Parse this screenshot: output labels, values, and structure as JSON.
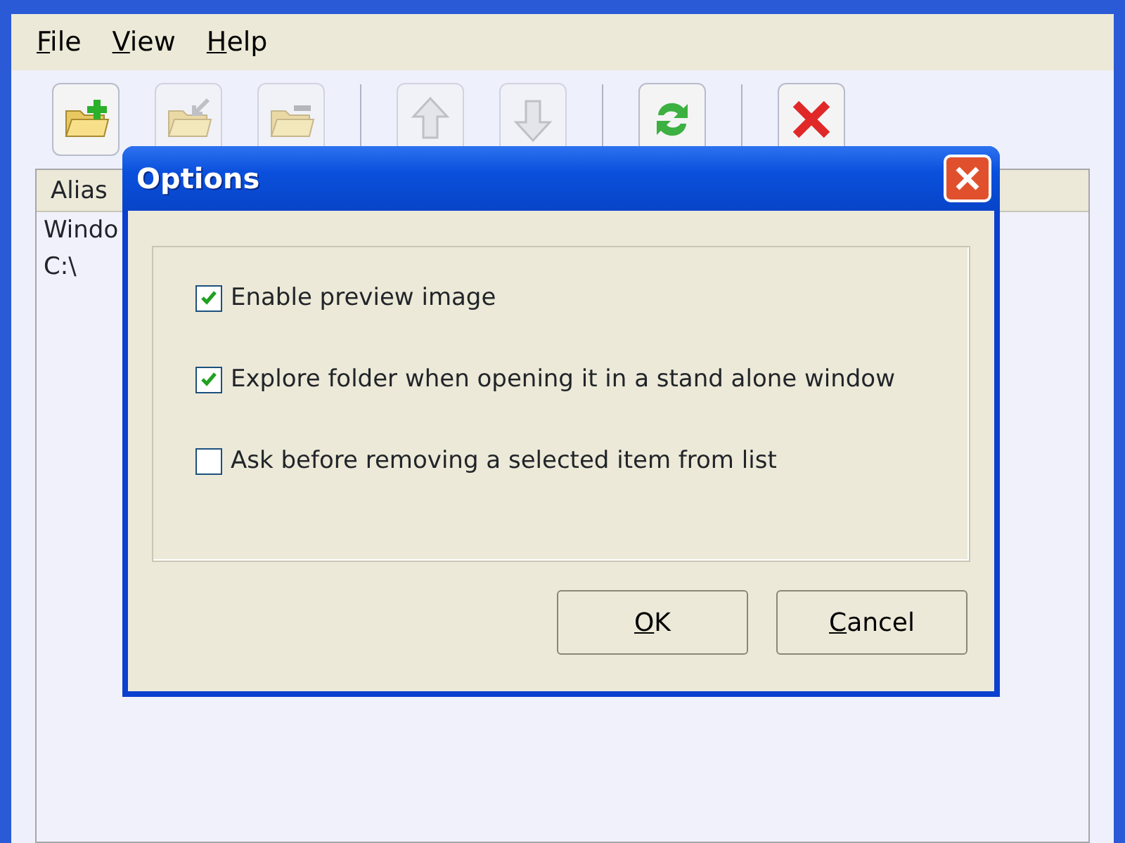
{
  "menu": [
    {
      "label": "File"
    },
    {
      "label": "View"
    },
    {
      "label": "Help"
    }
  ],
  "toolbar": [
    {
      "kind": "add",
      "disabled": false
    },
    {
      "kind": "import",
      "disabled": true
    },
    {
      "kind": "folder",
      "disabled": true
    },
    {
      "kind": "sep"
    },
    {
      "kind": "up",
      "disabled": true
    },
    {
      "kind": "down",
      "disabled": true
    },
    {
      "kind": "sep"
    },
    {
      "kind": "refresh",
      "disabled": false
    },
    {
      "kind": "sep"
    },
    {
      "kind": "delete",
      "disabled": false
    }
  ],
  "list": {
    "columns": [
      "Alias"
    ],
    "rows": [
      "Windo",
      "C:\\"
    ]
  },
  "dialog": {
    "title": "Options",
    "options": [
      {
        "label": "Enable preview image",
        "checked": true
      },
      {
        "label": "Explore folder when opening it in a stand alone window",
        "checked": true
      },
      {
        "label": "Ask before removing a selected item from list",
        "checked": false
      }
    ],
    "buttons": [
      "OK",
      "Cancel"
    ]
  }
}
